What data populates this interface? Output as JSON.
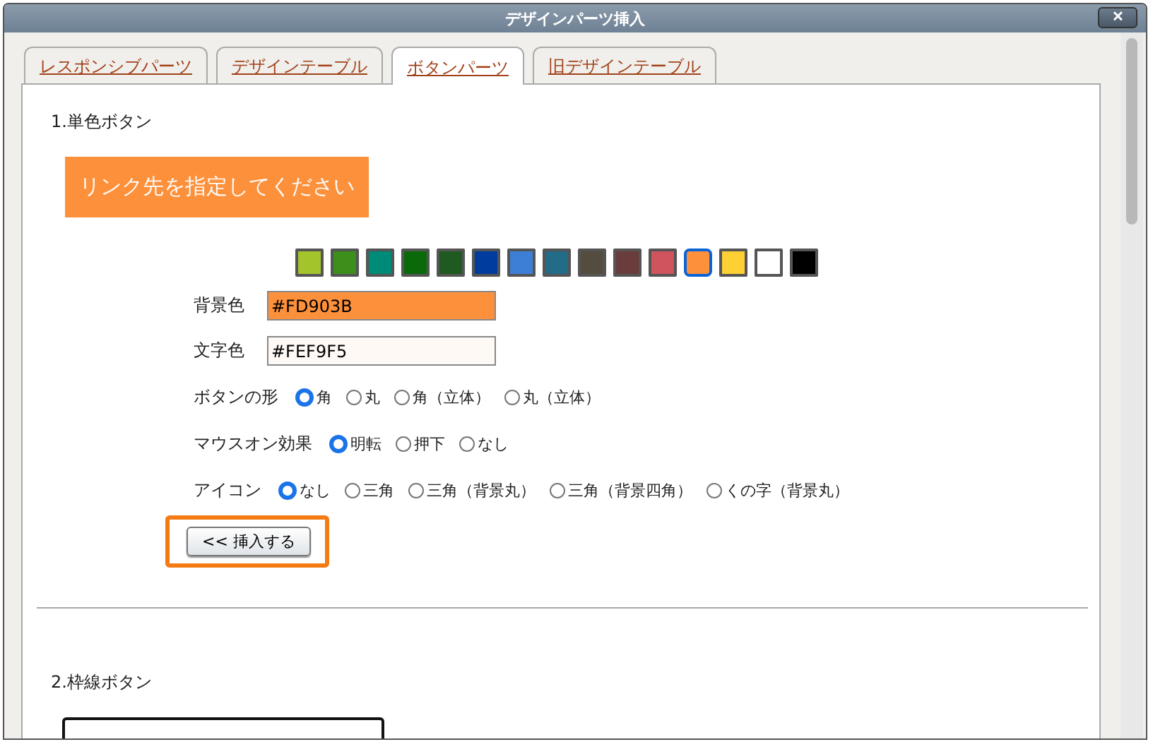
{
  "window": {
    "title": "デザインパーツ挿入",
    "close": "✕"
  },
  "tabs": [
    {
      "label": "レスポンシブパーツ",
      "selected": false
    },
    {
      "label": "デザインテーブル",
      "selected": false
    },
    {
      "label": "ボタンパーツ",
      "selected": true
    },
    {
      "label": "旧デザインテーブル",
      "selected": false
    }
  ],
  "section1": {
    "heading": "1.単色ボタン",
    "preview_label": "リンク先を指定してください",
    "swatches": [
      {
        "color": "#a4c42c",
        "selected": false
      },
      {
        "color": "#3c8f1a",
        "selected": false
      },
      {
        "color": "#008a78",
        "selected": false
      },
      {
        "color": "#0a6a0a",
        "selected": false
      },
      {
        "color": "#1f5a20",
        "selected": false
      },
      {
        "color": "#003c9e",
        "selected": false
      },
      {
        "color": "#3d7fd6",
        "selected": false
      },
      {
        "color": "#226c88",
        "selected": false
      },
      {
        "color": "#544c3e",
        "selected": false
      },
      {
        "color": "#6a3c3c",
        "selected": false
      },
      {
        "color": "#d0545e",
        "selected": false
      },
      {
        "color": "#fd903b",
        "selected": true
      },
      {
        "color": "#fed034",
        "selected": false
      },
      {
        "color": "#ffffff",
        "selected": false
      },
      {
        "color": "#000000",
        "selected": false
      }
    ],
    "fields": [
      {
        "label": "背景色",
        "value": "#FD903B"
      },
      {
        "label": "文字色",
        "value": "#FEF9F5"
      }
    ],
    "radio_groups": [
      {
        "label": "ボタンの形",
        "options": [
          {
            "label": "角",
            "selected": true
          },
          {
            "label": "丸",
            "selected": false
          },
          {
            "label": "角（立体）",
            "selected": false
          },
          {
            "label": "丸（立体）",
            "selected": false
          }
        ]
      },
      {
        "label": "マウスオン効果",
        "options": [
          {
            "label": "明転",
            "selected": true
          },
          {
            "label": "押下",
            "selected": false
          },
          {
            "label": "なし",
            "selected": false
          }
        ]
      },
      {
        "label": "アイコン",
        "options": [
          {
            "label": "なし",
            "selected": true
          },
          {
            "label": "三角",
            "selected": false
          },
          {
            "label": "三角（背景丸）",
            "selected": false
          },
          {
            "label": "三角（背景四角）",
            "selected": false
          },
          {
            "label": "くの字（背景丸）",
            "selected": false
          }
        ]
      }
    ],
    "insert_button": "<< 挿入する"
  },
  "section2": {
    "heading": "2.枠線ボタン"
  }
}
